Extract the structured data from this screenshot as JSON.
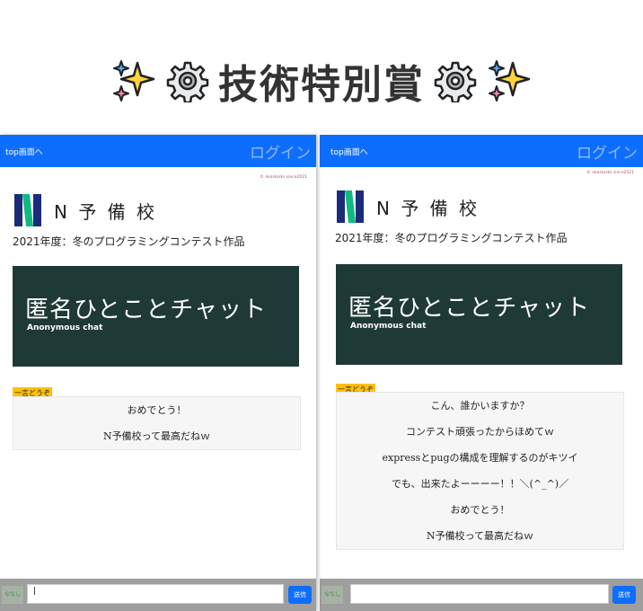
{
  "banner": {
    "title": "技術特別賞",
    "icons": [
      "sparkles-icon",
      "gear-icon",
      "gear-icon",
      "sparkles-icon"
    ]
  },
  "panels": [
    {
      "nav": {
        "top_link": "top画面へ",
        "login": "ログイン"
      },
      "copyright": "© nkarkarks since2021",
      "logo_text": "N 予 備 校",
      "subtitle": "2021年度：冬のプログラミングコンテスト作品",
      "chat_title": "匿名ひとことチャット",
      "chat_subtitle": "Anonymous chat",
      "tag": "一言どうぞ",
      "messages": [
        "おめでとう！",
        "N予備校って最高だねｗ"
      ],
      "name_label": "ななし",
      "input_value": "|",
      "send_label": "送信"
    },
    {
      "nav": {
        "top_link": "top画面へ",
        "login": "ログイン"
      },
      "copyright": "© nkarkarks since2021",
      "logo_text": "N 予 備 校",
      "subtitle": "2021年度：冬のプログラミングコンテスト作品",
      "chat_title": "匿名ひとことチャット",
      "chat_subtitle": "Anonymous chat",
      "tag": "一言どうぞ",
      "messages": [
        "こん、誰かいますか？",
        "コンテスト頑張ったからほめてｗ",
        "expressとpugの構成を理解するのがキツイ",
        "でも、出来たよーーーー！！＼(^_^)／",
        "おめでとう！",
        "N予備校って最高だねｗ"
      ],
      "name_label": "ななし",
      "input_value": "",
      "send_label": "送信"
    }
  ],
  "colors": {
    "navbar": "#0d6efd",
    "chat_box": "#1f3a36",
    "tag": "#ffc107",
    "logo_blue": "#1a2b7a",
    "logo_green": "#10b981"
  }
}
